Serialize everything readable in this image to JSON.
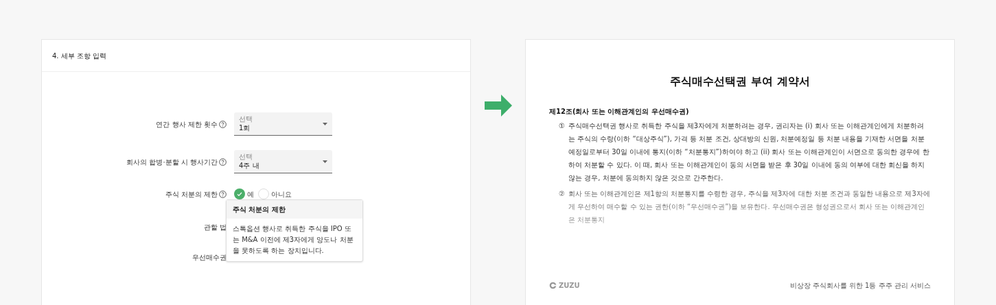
{
  "form": {
    "title": "4. 세부 조항 입력",
    "rows": [
      {
        "kind": "select",
        "label": "연간 행사 제한 횟수",
        "select_label": "선택",
        "value": "1회"
      },
      {
        "kind": "select",
        "label": "회사의 합병·분할 시 행사기간",
        "select_label": "선택",
        "value": "4주 내"
      },
      {
        "kind": "radio",
        "label": "주식 처분의 제한",
        "options": [
          {
            "label": "예",
            "selected": true
          },
          {
            "label": "아니요",
            "selected": false
          }
        ]
      },
      {
        "kind": "covered",
        "label": "관할 법"
      },
      {
        "kind": "covered",
        "label": "우선매수권"
      }
    ],
    "tooltip": {
      "title": "주식 처분의 제한",
      "body": "스톡옵션 행사로 취득한 주식을 IPO 또는 M&A 이전에 제3자에게 양도나 처분을 못하도록 하는 장치입니다."
    }
  },
  "document": {
    "title": "주식매수선택권 부여 계약서",
    "article": "제12조(회사 또는 이해관계인의 우선매수권)",
    "clauses": [
      {
        "number": "①",
        "text": "주식매수선택권 행사로 취득한 주식을 제3자에게 처분하려는 경우, 권리자는 (i) 회사 또는 이해관계인에게 처분하려는 주식의 수량(이하 “대상주식”), 가격 등 처분 조건, 상대방의 신원, 처분예정일 등 처분 내용을 기재한 서면을 처분예정일로부터 30일 이내에 통지(이하 “처분통지”)하여야 하고 (ii) 회사 또는 이해관계인이 서면으로 동의한 경우에 한하여 처분할 수 있다. 이 때, 회사 또는 이해관계인이 동의 서면을 받은 후 30일 이내에 동의 여부에 대한 회신을 하지 않는 경우, 처분에 동의하지 않은 것으로 간주한다."
      },
      {
        "number": "②",
        "text": "회사 또는 이해관계인은 제1항의 처분통지를 수령한 경우, 주식을 제3자에 대한 처분 조건과 동일한 내용으로 제3자에게 우선하여 매수할 수 있는 권한(이하 “우선매수권”)을 보유한다. 우선매수권은 형성권으로서 회사 또는 이해관계인은 처분통지"
      }
    ],
    "brand": "ZUZU",
    "tagline": "비상장 주식회사를 위한 1등 주주 관리 서비스"
  }
}
